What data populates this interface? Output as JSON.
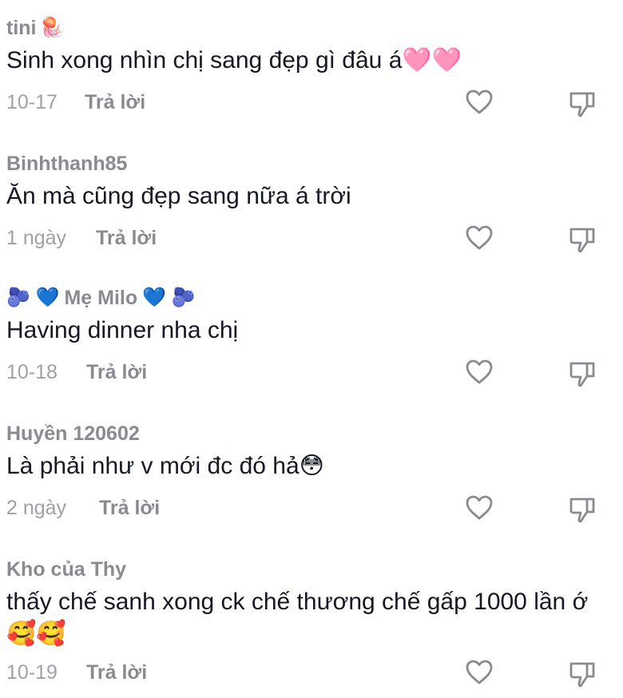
{
  "comments": [
    {
      "username": "tini",
      "username_suffix_emoji": "🪼",
      "text": "Sinh xong nhìn chị sang đẹp gì đâu á",
      "text_emoji": "🩷🩷",
      "date": "10-17",
      "reply_label": "Trả lời"
    },
    {
      "username": "Binhthanh85",
      "text": "Ăn mà cũng đẹp sang nữa á trời",
      "date": "1 ngày",
      "reply_label": "Trả lời"
    },
    {
      "username": "Mẹ Milo",
      "username_prefix_emoji": "🫐 💙",
      "username_suffix_emoji": "💙 🫐",
      "text": "Having dinner nha chị",
      "date": "10-18",
      "reply_label": "Trả lời"
    },
    {
      "username": "Huyền 120602",
      "text": "Là phải như v mới đc đó hả",
      "text_emoji": "😳",
      "date": "2 ngày",
      "reply_label": "Trả lời"
    },
    {
      "username": "Kho của Thy",
      "text": "thấy chế sanh xong ck chế thương chế gấp 1000 lần ớ",
      "text_emoji": "🥰🥰",
      "date": "10-19",
      "reply_label": "Trả lời"
    }
  ],
  "icons": {
    "like": "heart-outline-icon",
    "dislike": "thumbs-down-outline-icon"
  },
  "colors": {
    "username": "#8a8b91",
    "text": "#161823",
    "date": "#a0a1a6",
    "icon": "#8a8b91"
  }
}
